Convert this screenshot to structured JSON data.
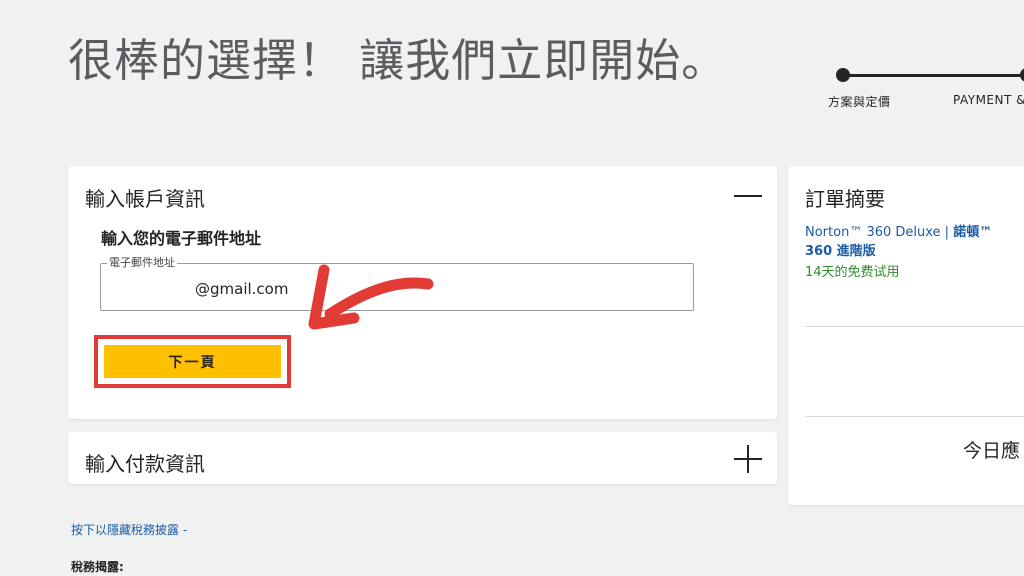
{
  "header": {
    "title": "很棒的選擇！ 讓我們立即開始。"
  },
  "stepper": {
    "steps": [
      {
        "label": "方案與定價"
      },
      {
        "label": "PAYMENT &"
      }
    ]
  },
  "account_card": {
    "title": "輸入帳戶資訊",
    "toggle_icon": "minus-icon",
    "email_heading": "輸入您的電子郵件地址",
    "email_field": {
      "label": "電子郵件地址",
      "value": "@gmail.com"
    },
    "next_button": "下一頁"
  },
  "payment_card": {
    "title": "輸入付款資訊",
    "toggle_icon": "plus-icon"
  },
  "order_summary": {
    "title": "訂單摘要",
    "product_line1": "Norton™ 360 Deluxe | ",
    "product_line1_bold": "諾頓™",
    "product_line2": "360 進階版",
    "trial": "14天的免费试用",
    "today_label": "今日應"
  },
  "tax": {
    "link": "按下以隱藏稅務披露 -",
    "label": "稅務揭露:"
  },
  "annotation": {
    "highlight_color": "#e23b35",
    "button_color": "#fec001"
  }
}
